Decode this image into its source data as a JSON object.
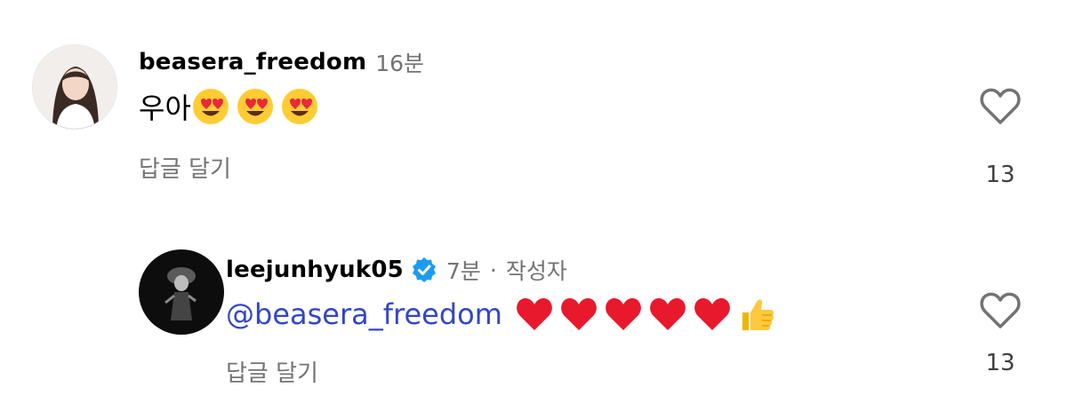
{
  "comments": [
    {
      "username": "beasera_freedom",
      "time": "16분",
      "text": "우아",
      "emojis": [
        "heart-eyes",
        "heart-eyes",
        "heart-eyes"
      ],
      "reply_label": "답글 달기",
      "like_count": "13"
    },
    {
      "username": "leejunhyuk05",
      "verified": true,
      "time": "7분",
      "separator": "·",
      "author_badge": "작성자",
      "mention": "@beasera_freedom",
      "emojis": [
        "red-heart",
        "red-heart",
        "red-heart",
        "red-heart",
        "red-heart",
        "thumbs-up"
      ],
      "reply_label": "답글 달기",
      "like_count": "13"
    }
  ],
  "colors": {
    "mention": "#3246c8",
    "secondary": "#737373",
    "verified": "#1d9bf0"
  }
}
